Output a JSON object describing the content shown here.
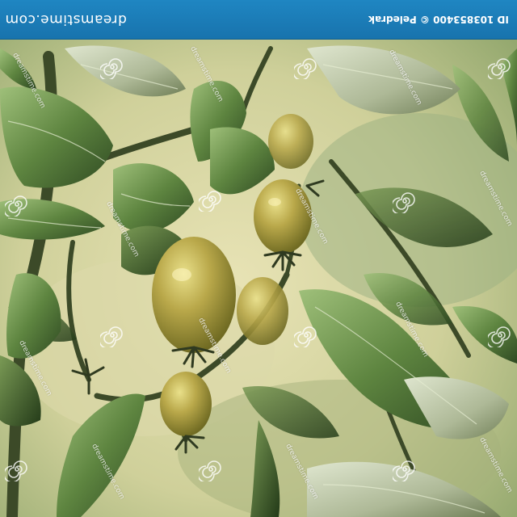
{
  "banner": {
    "brand": "dreamstime.com",
    "image_id": "ID 103853400 © Peledrak"
  },
  "watermark": {
    "text": "dreamstime.com",
    "icon": "dreamstime-swirl-icon"
  },
  "photo": {
    "subject": "",
    "icon": "tomato-vine-photo"
  },
  "colors": {
    "banner": "#1c7fbb",
    "leaf": "#5f7f3e",
    "fruit": "#9c9a3a"
  }
}
